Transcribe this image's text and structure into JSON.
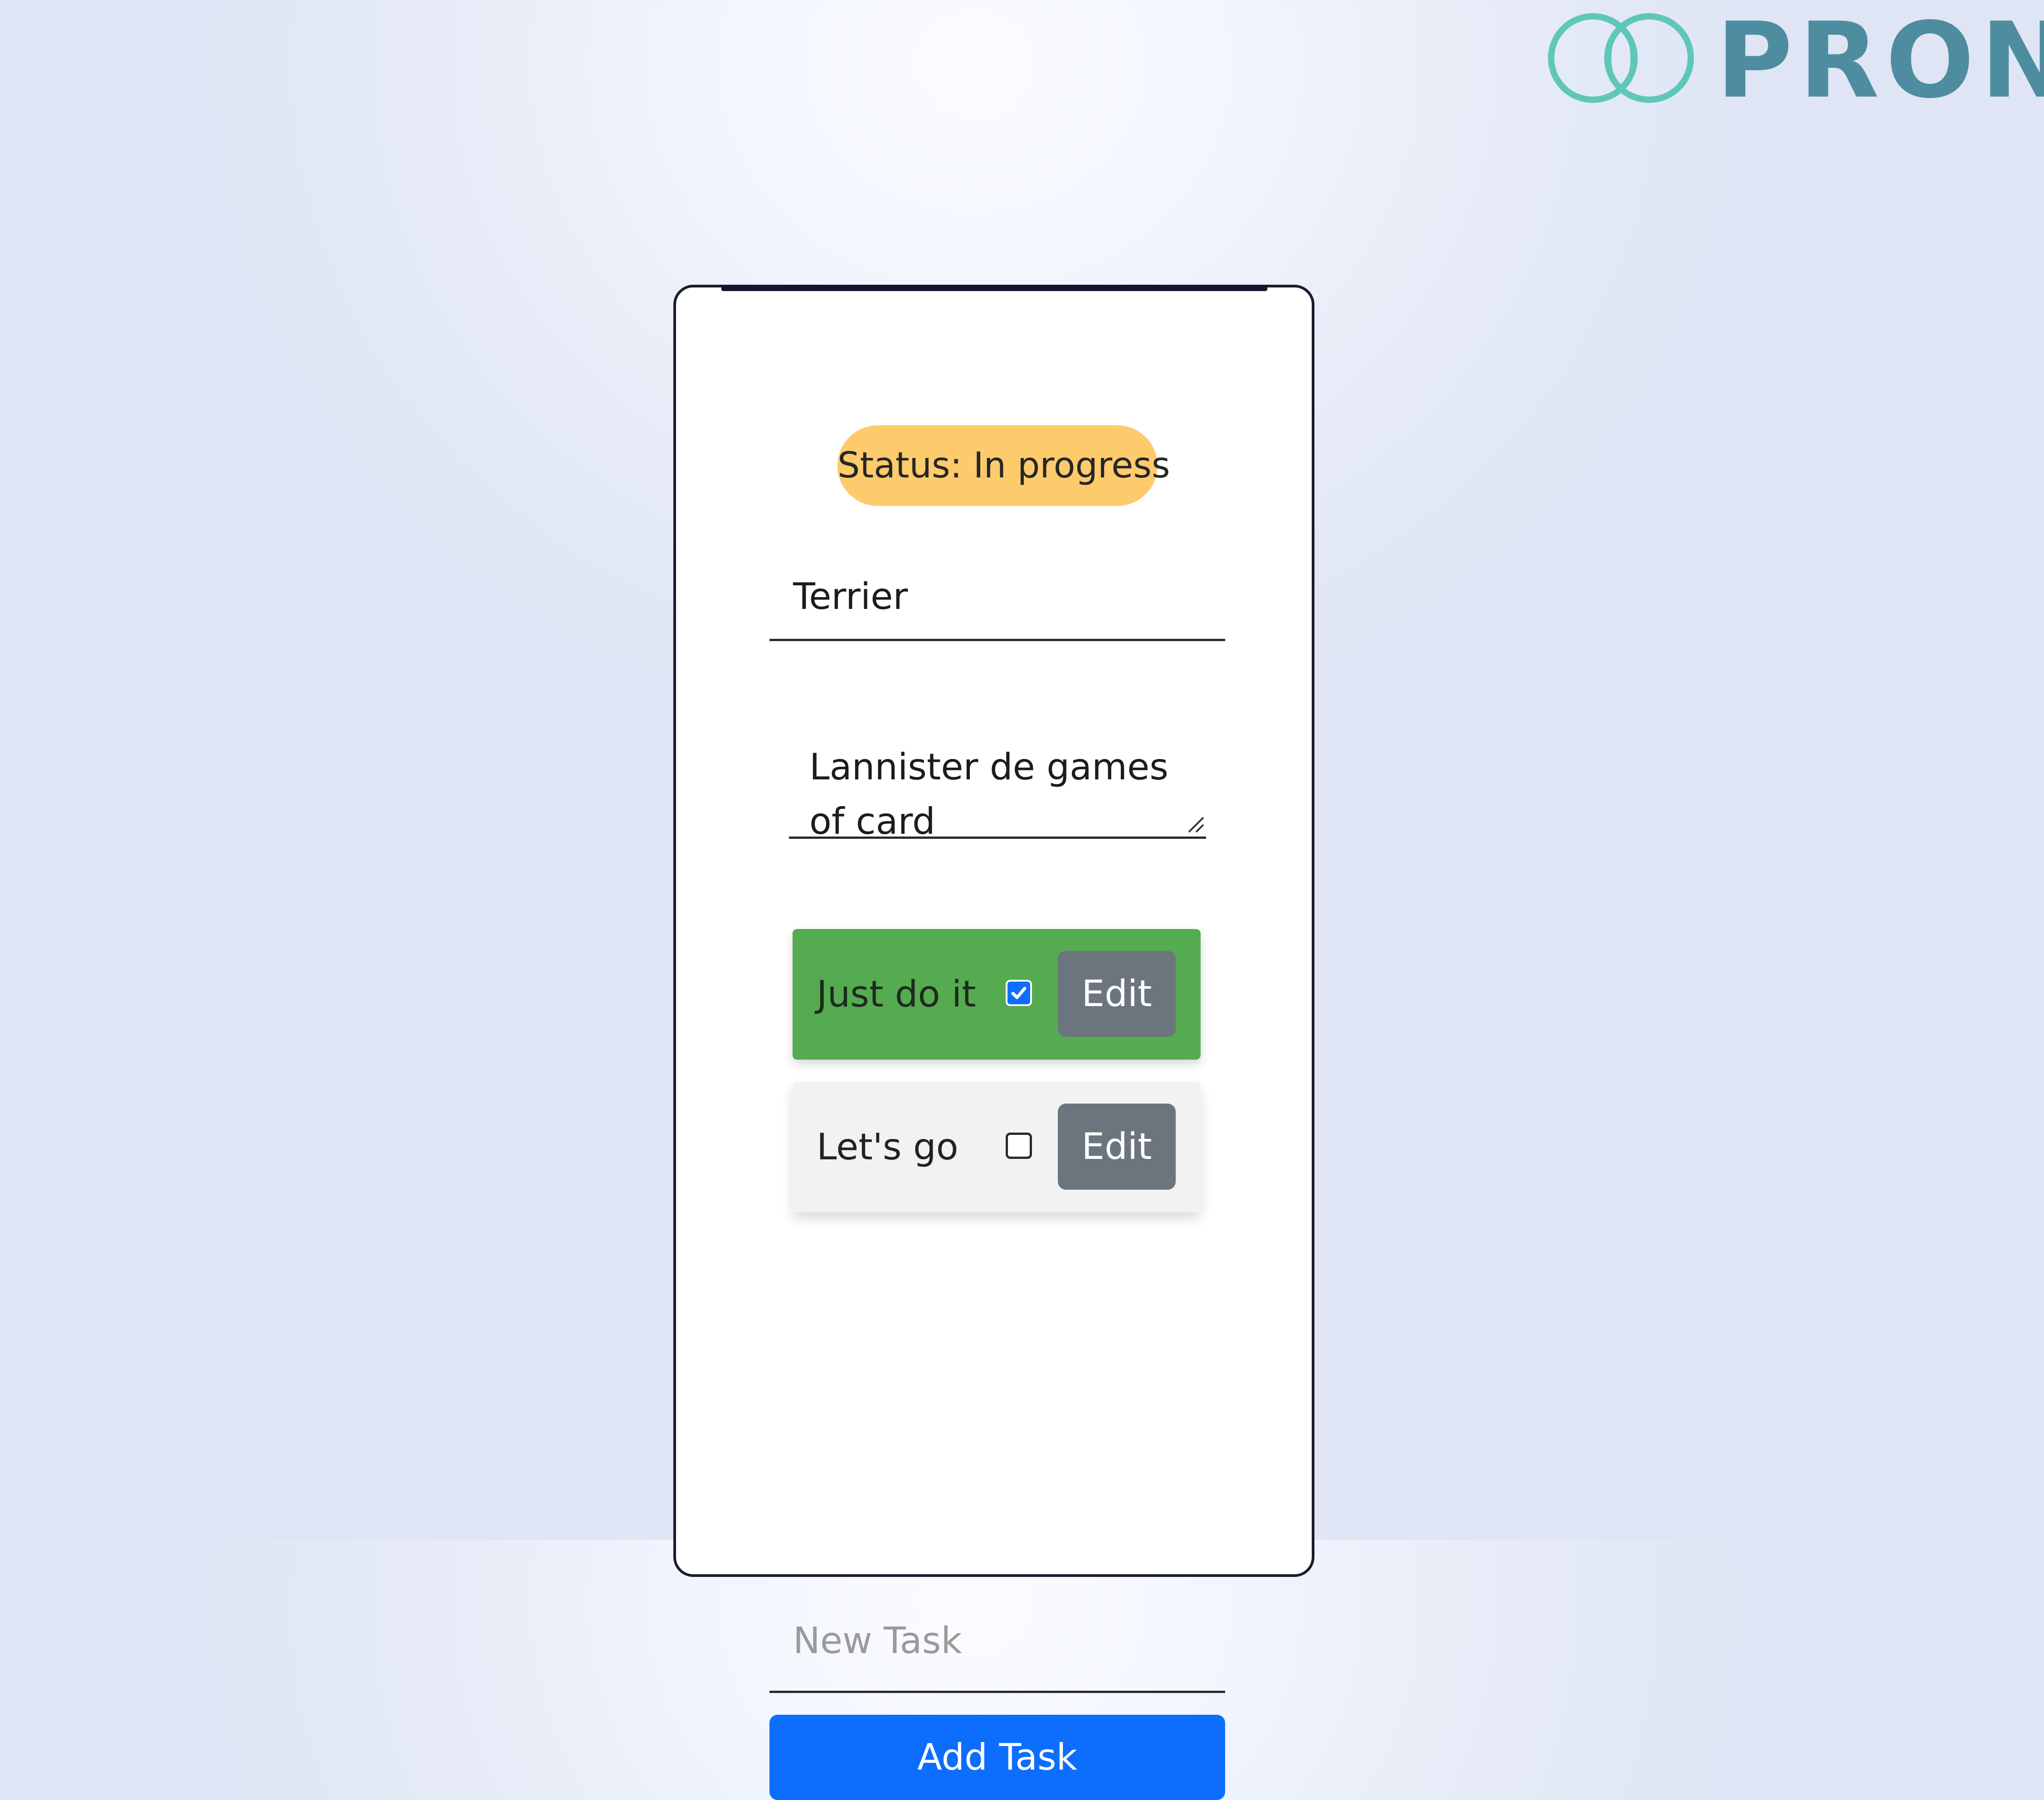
{
  "logo": {
    "text": "PRONO",
    "color": "#4e8d9f",
    "mark_color": "#5ec7b8"
  },
  "status": {
    "label": "Status: In progress",
    "color": "#fdcb6b"
  },
  "title_input": {
    "value": "Terrier"
  },
  "description_textarea": {
    "value": "Lannister de games of card"
  },
  "tasks": [
    {
      "label": "Just do it",
      "completed": true,
      "edit_label": "Edit",
      "background": "#55ab4f"
    },
    {
      "label": "Let's go",
      "completed": false,
      "edit_label": "Edit",
      "background": "#f2f2f2"
    }
  ],
  "new_task": {
    "placeholder": "New Task",
    "value": ""
  },
  "add_task_button": {
    "label": "Add Task",
    "color": "#0d6efd"
  },
  "colors": {
    "edit_button": "#6c757d",
    "checkbox_checked": "#0d6efd"
  }
}
